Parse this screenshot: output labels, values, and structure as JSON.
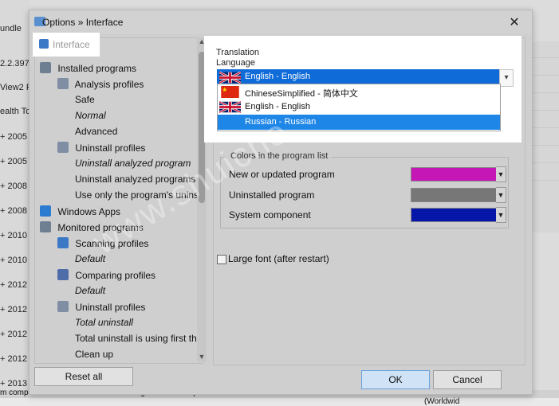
{
  "window": {
    "title": "Options » Interface",
    "close_glyph": "✕"
  },
  "background_app": {
    "left_column": [
      "undle",
      "2.2.397",
      "View2 F",
      "ealth To",
      "+ 2005 I",
      "+ 2005 I",
      "+ 2008 I",
      "+ 2008 I",
      "+ 2010",
      "+ 2010",
      "+ 2012 I",
      "+ 2012 I",
      "+ 2012 I",
      "+ 2012 I",
      "+ 2013 I"
    ],
    "right_column": [
      "...",
      "...",
      "...",
      "...",
      "...",
      "...",
      "...",
      "..."
    ],
    "status": {
      "left": "m components",
      "middle": "Pending file rename operations.",
      "right": "Licensed to \"Gavrila Martau\" (Worldwid"
    }
  },
  "tree": {
    "items": [
      {
        "label": "Interface",
        "icon": "interface-icon",
        "selected": true,
        "italic": false
      },
      {
        "label": "Installed programs",
        "icon": "installed-programs-icon",
        "selected": false,
        "italic": false
      },
      {
        "label": "Analysis profiles",
        "icon": "analysis-profiles-icon",
        "selected": false,
        "italic": false
      },
      {
        "label": "Safe",
        "icon": "",
        "selected": false,
        "italic": false
      },
      {
        "label": "Normal",
        "icon": "",
        "selected": false,
        "italic": true
      },
      {
        "label": "Advanced",
        "icon": "",
        "selected": false,
        "italic": false
      },
      {
        "label": "Uninstall profiles",
        "icon": "uninstall-profiles-icon",
        "selected": false,
        "italic": false
      },
      {
        "label": "Uninstall analyzed program",
        "icon": "",
        "selected": false,
        "italic": true
      },
      {
        "label": "Uninstall analyzed programs - b...",
        "icon": "",
        "selected": false,
        "italic": false
      },
      {
        "label": "Use only the program's uninstal...",
        "icon": "",
        "selected": false,
        "italic": false
      },
      {
        "label": "Windows Apps",
        "icon": "windows-apps-icon",
        "selected": false,
        "italic": false
      },
      {
        "label": "Monitored programs",
        "icon": "monitored-programs-icon",
        "selected": false,
        "italic": false
      },
      {
        "label": "Scanning profiles",
        "icon": "scanning-profiles-icon",
        "selected": false,
        "italic": false
      },
      {
        "label": "Default",
        "icon": "",
        "selected": false,
        "italic": true
      },
      {
        "label": "Comparing profiles",
        "icon": "comparing-profiles-icon",
        "selected": false,
        "italic": false
      },
      {
        "label": "Default",
        "icon": "",
        "selected": false,
        "italic": true
      },
      {
        "label": "Uninstall profiles",
        "icon": "uninstall-profiles-icon",
        "selected": false,
        "italic": false
      },
      {
        "label": "Total uninstall",
        "icon": "",
        "selected": false,
        "italic": true
      },
      {
        "label": "Total uninstall is using first the ...",
        "icon": "",
        "selected": false,
        "italic": false
      },
      {
        "label": "Clean up",
        "icon": "",
        "selected": false,
        "italic": false
      }
    ]
  },
  "translation": {
    "group_title": "Translation",
    "language_label": "Language",
    "selected": "English - English",
    "options": [
      {
        "label": "ChineseSimplified - 简体中文",
        "flag": "china-flag-icon",
        "selected": false
      },
      {
        "label": "English - English",
        "flag": "uk-flag-icon",
        "selected": false
      },
      {
        "label": "Russian - Russian",
        "flag": "",
        "selected": true
      }
    ]
  },
  "colors_group": {
    "title": "Colors in the program list",
    "rows": [
      {
        "label": "New or updated program",
        "color": "#c417b5"
      },
      {
        "label": "Uninstalled program",
        "color": "#777777"
      },
      {
        "label": "System component",
        "color": "#0616a8"
      }
    ]
  },
  "options": {
    "large_font_label": "Large font (after restart)",
    "large_font_checked": false
  },
  "buttons": {
    "reset_all": "Reset all",
    "ok": "OK",
    "cancel": "Cancel"
  },
  "watermark": "www.shuiche"
}
